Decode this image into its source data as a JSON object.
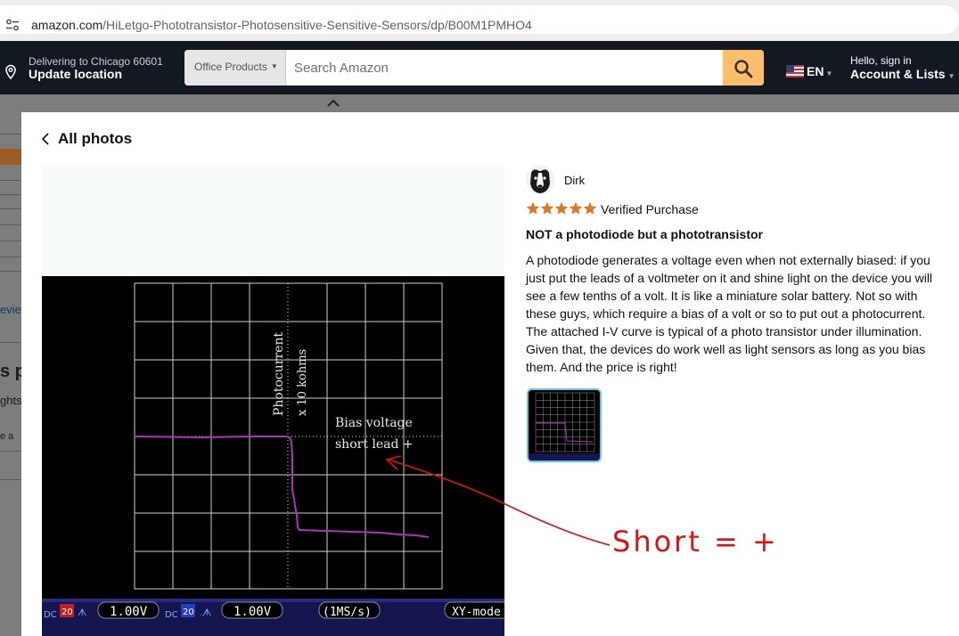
{
  "browser": {
    "url_host": "amazon.com",
    "url_path": "/HiLetgo-Phototransistor-Photosensitive-Sensitive-Sensors/dp/B00M1PMHO4"
  },
  "header": {
    "deliver_line1": "Delivering to Chicago 60601",
    "deliver_line2": "Update location",
    "search_category": "Office Products",
    "search_placeholder": "Search Amazon",
    "language": "EN",
    "account_line1": "Hello, sign in",
    "account_line2": "Account & Lists"
  },
  "background_page": {
    "fragments": [
      "eviev",
      "s p",
      "ghts",
      "e a"
    ]
  },
  "modal": {
    "back_label": "All photos",
    "review": {
      "author": "Dirk",
      "rating": 5,
      "verified": "Verified Purchase",
      "title": "NOT a photodiode but a phototransistor",
      "body": "A photodiode generates a voltage even when not externally biased: if you just put the leads of a voltmeter on it and shine light on the device you will see a few tenths of a volt. It is like a miniature solar battery. Not so with these guys, which require a bias of a volt or so to put out a photocurrent. The attached I-V curve is typical of a photo transistor under illumination. Given that, the devices do work well as light sensors as long as you bias them. And the price is right!"
    },
    "scope_image": {
      "y_axis_label_1": "Photocurrent",
      "y_axis_label_2": "x 10 kohms",
      "bias_label_1": "Bias voltage",
      "bias_label_2": "short lead +",
      "ch1_coupling": "DC",
      "ch1_probe": "20",
      "ch1_scale": "1.00V",
      "ch2_coupling": "DC",
      "ch2_probe": "20",
      "ch2_scale": "1.00V",
      "timebase": "(1MS/s)",
      "mode": "XY-mode"
    },
    "annotation": "Short = +"
  },
  "colors": {
    "nav_bg": "#131921",
    "search_button": "#febd69",
    "star": "#de7921",
    "trace": "#b030c0",
    "annotation_red": "#e01010",
    "thumb_border": "#62c6e6"
  }
}
